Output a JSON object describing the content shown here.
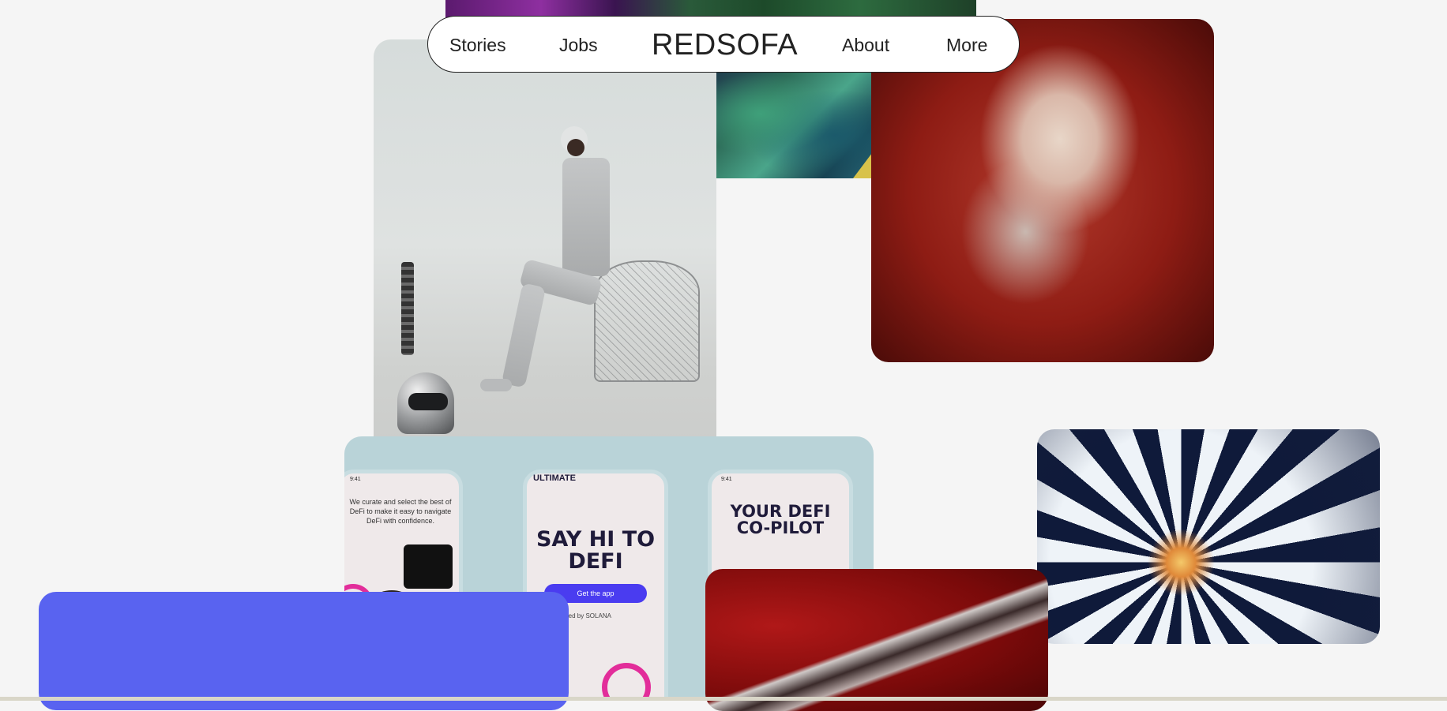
{
  "nav": {
    "items_left": [
      "Stories",
      "Jobs"
    ],
    "brand": "REDSOFA",
    "items_right": [
      "About",
      "More"
    ]
  },
  "app_mockup": {
    "left_phone": {
      "time": "9:41",
      "text": "We curate and select the best of DeFi to make it easy to navigate DeFi with confidence."
    },
    "mid_phone": {
      "header": "ULTIMATE",
      "headline": "SAY HI TO DEFI",
      "button": "Get the app",
      "powered_by": "Powered by  SOLANA"
    },
    "right_phone": {
      "time": "9:41",
      "headline": "YOUR DEFI CO-PILOT"
    }
  },
  "colors": {
    "background": "#f5f5f5",
    "blue_block": "#5963f0",
    "accent_pink": "#e22d9a",
    "button_purple": "#4a3cf0"
  }
}
